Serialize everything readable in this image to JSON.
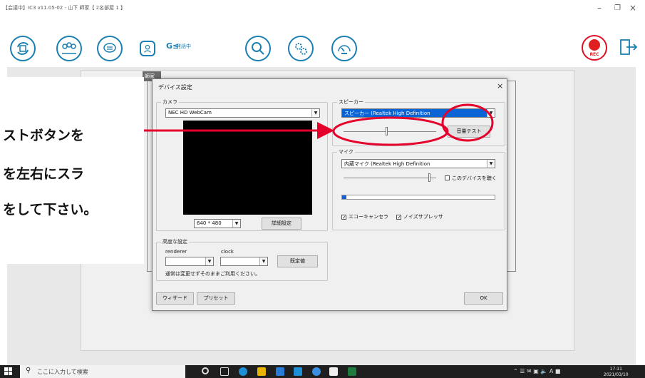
{
  "app": {
    "title": "【会議中】IC3 v11.05-02 - 山下  師家【 2名部屋 1 】",
    "status_label": "発話中",
    "rec_label": "REC",
    "bg_window_tab": "師家",
    "toolbar_icons": [
      "sync-icon",
      "participants-icon",
      "chat-icon",
      "profile-list-icon",
      "search-icon",
      "settings-gears-icon",
      "meter-icon"
    ],
    "colors": {
      "accent": "#1a7fb2",
      "rec": "#e02020",
      "highlight": "#e4002b"
    }
  },
  "dialog": {
    "title": "デバイス設定",
    "close_glyph": "×",
    "camera": {
      "group_label": "カメラ",
      "device": "NEC HD WebCam",
      "resolution": "640 * 480",
      "detail_button": "詳細設定"
    },
    "advanced": {
      "group_label": "高度な設定",
      "renderer_label": "renderer",
      "clock_label": "clock",
      "renderer_value": "",
      "clock_value": "",
      "default_button": "既定値",
      "note": "通常は変更せずそのままご利用ください。"
    },
    "speaker": {
      "group_label": "スピーカー",
      "device": "スピーカー (Realtek High Definition",
      "test_button": "音量テスト",
      "volume_level": 0.47
    },
    "mic": {
      "group_label": "マイク",
      "device": "内蔵マイク (Realtek High Definition",
      "listen_label": "このデバイスを聴く",
      "listen_checked": false,
      "volume_level": 0.93,
      "input_level": 0.03,
      "echo_cancel_label": "エコーキャンセラ",
      "echo_cancel_checked": true,
      "noise_suppress_label": "ノイズサプレッサ",
      "noise_suppress_checked": true
    },
    "footer": {
      "wizard_button": "ウィザード",
      "preset_button": "プリセット",
      "ok_button": "OK"
    }
  },
  "callout": {
    "lines": [
      "ストボタンを",
      "を左右にスラ",
      "をして下さい。"
    ]
  },
  "taskbar": {
    "search_placeholder": "ここに入力して検索",
    "search_icon": "search-icon",
    "clock_time": "17:11",
    "clock_date": "2021/03/10"
  }
}
